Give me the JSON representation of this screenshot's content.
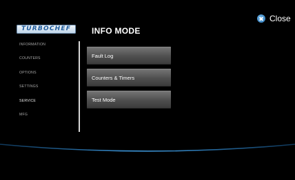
{
  "brand": {
    "logo_text": "TURBOCHEF"
  },
  "header": {
    "title": "INFO MODE",
    "close_label": "Close"
  },
  "sidebar": {
    "items": [
      {
        "label": "INFORMATION"
      },
      {
        "label": "COUNTERS"
      },
      {
        "label": "OPTIONS"
      },
      {
        "label": "SETTINGS"
      },
      {
        "label": "SERVICE"
      },
      {
        "label": "MFG"
      }
    ]
  },
  "main": {
    "buttons": [
      {
        "label": "Fault Log"
      },
      {
        "label": "Counters & Timers"
      },
      {
        "label": "Test Mode"
      }
    ]
  },
  "colors": {
    "accent": "#2a77b8",
    "background": "#000000",
    "button": "#4e4e4e"
  }
}
